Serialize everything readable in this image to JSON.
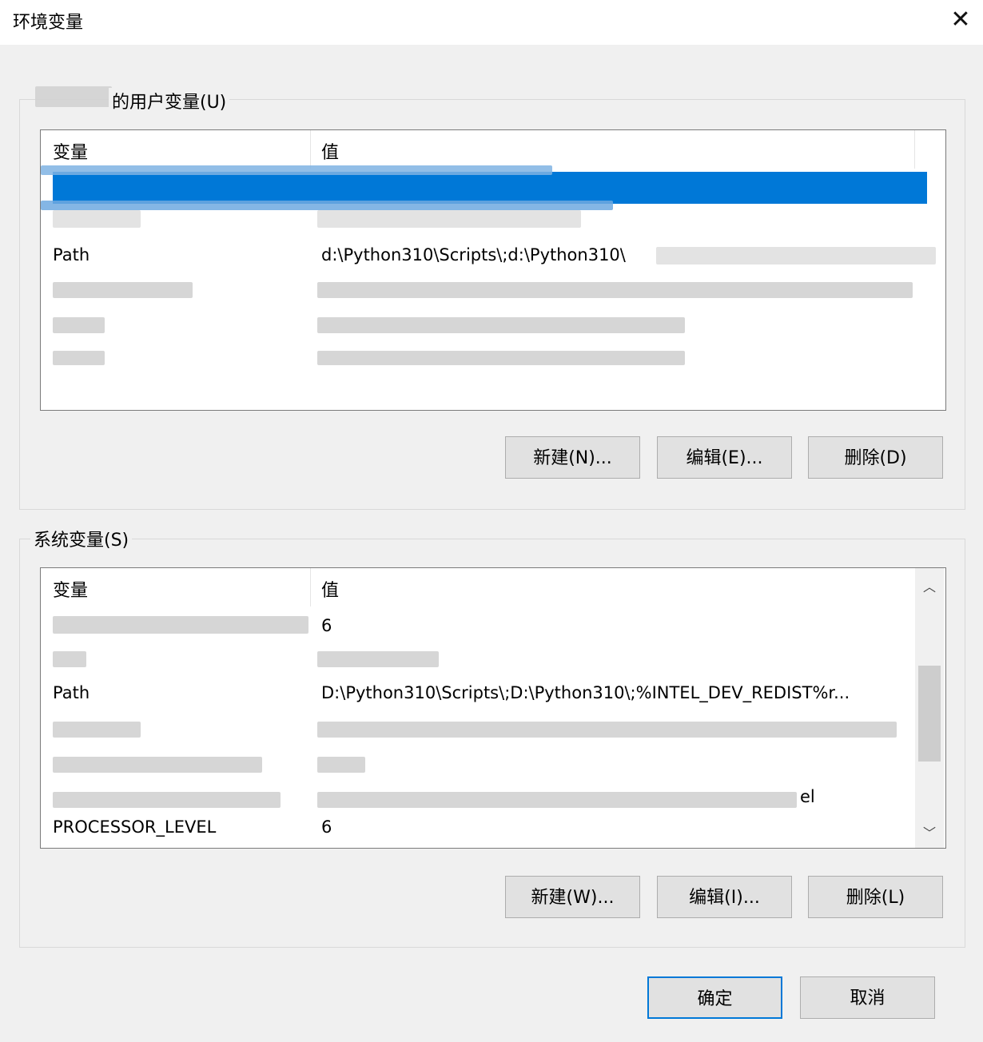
{
  "window": {
    "title": "环境变量",
    "close_icon": "close-icon"
  },
  "user_vars": {
    "label": "的用户变量(U)",
    "columns": [
      "变量",
      "值"
    ],
    "rows": [
      {
        "name": "Path",
        "value": "d:\\Python310\\Scripts\\;d:\\Python310\\"
      }
    ],
    "buttons": {
      "new": "新建(N)...",
      "edit": "编辑(E)...",
      "delete": "删除(D)"
    }
  },
  "system_vars": {
    "label": "系统变量(S)",
    "columns": [
      "变量",
      "值"
    ],
    "rows": [
      {
        "name": "",
        "value": "6"
      },
      {
        "name": "Path",
        "value": "D:\\Python310\\Scripts\\;D:\\Python310\\;%INTEL_DEV_REDIST%r..."
      },
      {
        "name": "",
        "value": "el"
      },
      {
        "name": "PROCESSOR_LEVEL",
        "value": "6"
      }
    ],
    "buttons": {
      "new": "新建(W)...",
      "edit": "编辑(I)...",
      "delete": "删除(L)"
    }
  },
  "footer": {
    "ok": "确定",
    "cancel": "取消"
  }
}
